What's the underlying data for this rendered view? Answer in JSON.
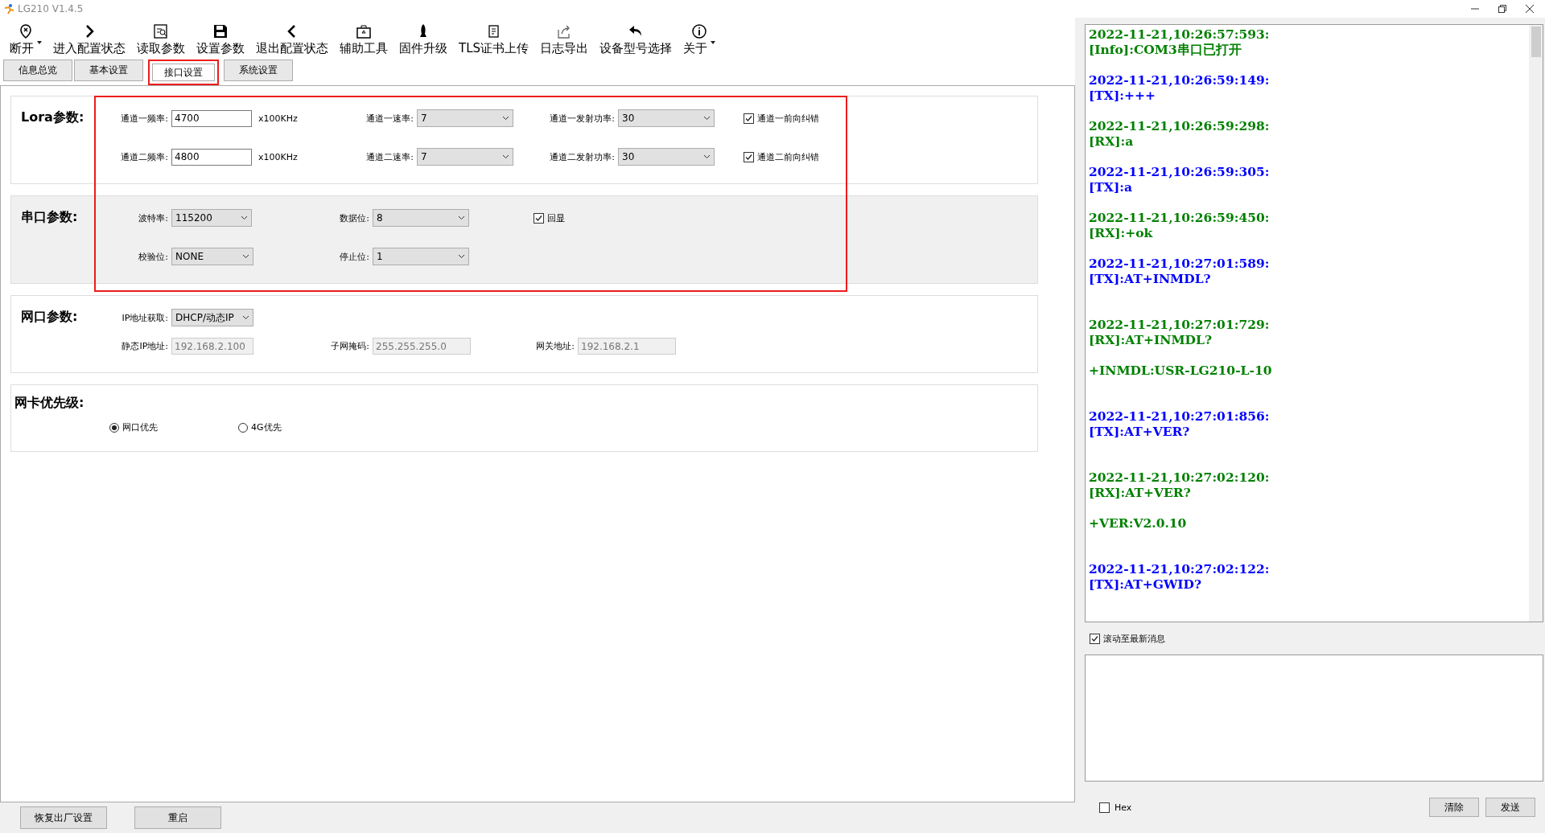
{
  "window": {
    "title": "LG210 V1.4.5"
  },
  "toolbar": [
    {
      "label": "断开",
      "dropdown": true
    },
    {
      "label": "进入配置状态",
      "dropdown": false
    },
    {
      "label": "读取参数",
      "dropdown": false
    },
    {
      "label": "设置参数",
      "dropdown": false
    },
    {
      "label": "退出配置状态",
      "dropdown": false
    },
    {
      "label": "辅助工具",
      "dropdown": false
    },
    {
      "label": "固件升级",
      "dropdown": false
    },
    {
      "label": "TLS证书上传",
      "dropdown": false
    },
    {
      "label": "日志导出",
      "dropdown": false
    },
    {
      "label": "设备型号选择",
      "dropdown": false
    },
    {
      "label": "关于",
      "dropdown": true
    }
  ],
  "tabs": [
    {
      "label": "信息总览",
      "selected": false,
      "highlighted": false
    },
    {
      "label": "基本设置",
      "selected": false,
      "highlighted": false
    },
    {
      "label": "接口设置",
      "selected": true,
      "highlighted": true
    },
    {
      "label": "系统设置",
      "selected": false,
      "highlighted": false
    }
  ],
  "params_highlighted": true,
  "lora": {
    "title": "Lora参数:",
    "rows": [
      {
        "freq_label": "通道一频率:",
        "freq": "4700",
        "unit": "x100KHz",
        "rate_label": "通道一速率:",
        "rate": "7",
        "power_label": "通道一发射功率:",
        "power": "30",
        "fec_label": "通道一前向纠错",
        "fec": true
      },
      {
        "freq_label": "通道二频率:",
        "freq": "4800",
        "unit": "x100KHz",
        "rate_label": "通道二速率:",
        "rate": "7",
        "power_label": "通道二发射功率:",
        "power": "30",
        "fec_label": "通道二前向纠错",
        "fec": true
      }
    ]
  },
  "serial": {
    "title": "串口参数:",
    "baud_label": "波特率:",
    "baud": "115200",
    "data_label": "数据位:",
    "data": "8",
    "echo_label": "回显",
    "echo": true,
    "parity_label": "校验位:",
    "parity": "NONE",
    "stop_label": "停止位:",
    "stop": "1"
  },
  "network": {
    "title": "网口参数:",
    "ip_mode_label": "IP地址获取:",
    "ip_mode": "DHCP/动态IP",
    "static_ip_label": "静态IP地址:",
    "static_ip": "192.168.2.100",
    "mask_label": "子网掩码:",
    "mask": "255.255.255.0",
    "gateway_label": "网关地址:",
    "gateway": "192.168.2.1"
  },
  "priority": {
    "title": "网卡优先级:",
    "options": [
      {
        "label": "网口优先",
        "selected": true
      },
      {
        "label": "4G优先",
        "selected": false
      }
    ]
  },
  "bottom_buttons": [
    "恢复出厂设置",
    "重启"
  ],
  "log": [
    {
      "kind": "rx",
      "lines": [
        "2022-11-21,10:26:57:593:",
        "[Info]:COM3串口已打开"
      ]
    },
    {
      "kind": "tx",
      "lines": [
        "2022-11-21,10:26:59:149:",
        "[TX]:+++"
      ]
    },
    {
      "kind": "rx",
      "lines": [
        "2022-11-21,10:26:59:298:",
        "[RX]:a"
      ]
    },
    {
      "kind": "tx",
      "lines": [
        "2022-11-21,10:26:59:305:",
        "[TX]:a"
      ]
    },
    {
      "kind": "rx",
      "lines": [
        "2022-11-21,10:26:59:450:",
        "[RX]:+ok"
      ]
    },
    {
      "kind": "tx",
      "lines": [
        "2022-11-21,10:27:01:589:",
        "[TX]:AT+INMDL?"
      ]
    },
    {
      "kind": "rx",
      "lines": [
        "2022-11-21,10:27:01:729:",
        "[RX]:AT+INMDL?"
      ],
      "reply": "+INMDL:USR-LG210-L-10"
    },
    {
      "kind": "tx",
      "lines": [
        "2022-11-21,10:27:01:856:",
        "[TX]:AT+VER?"
      ]
    },
    {
      "kind": "rx",
      "lines": [
        "2022-11-21,10:27:02:120:",
        "[RX]:AT+VER?"
      ],
      "reply": "+VER:V2.0.10"
    },
    {
      "kind": "tx",
      "lines": [
        "2022-11-21,10:27:02:122:",
        "[TX]:AT+GWID?"
      ]
    }
  ],
  "autoscroll": {
    "label": "滚动至最新消息",
    "checked": true
  },
  "hex": {
    "label": "Hex",
    "checked": false
  },
  "send_buttons": [
    "清除",
    "发送"
  ]
}
